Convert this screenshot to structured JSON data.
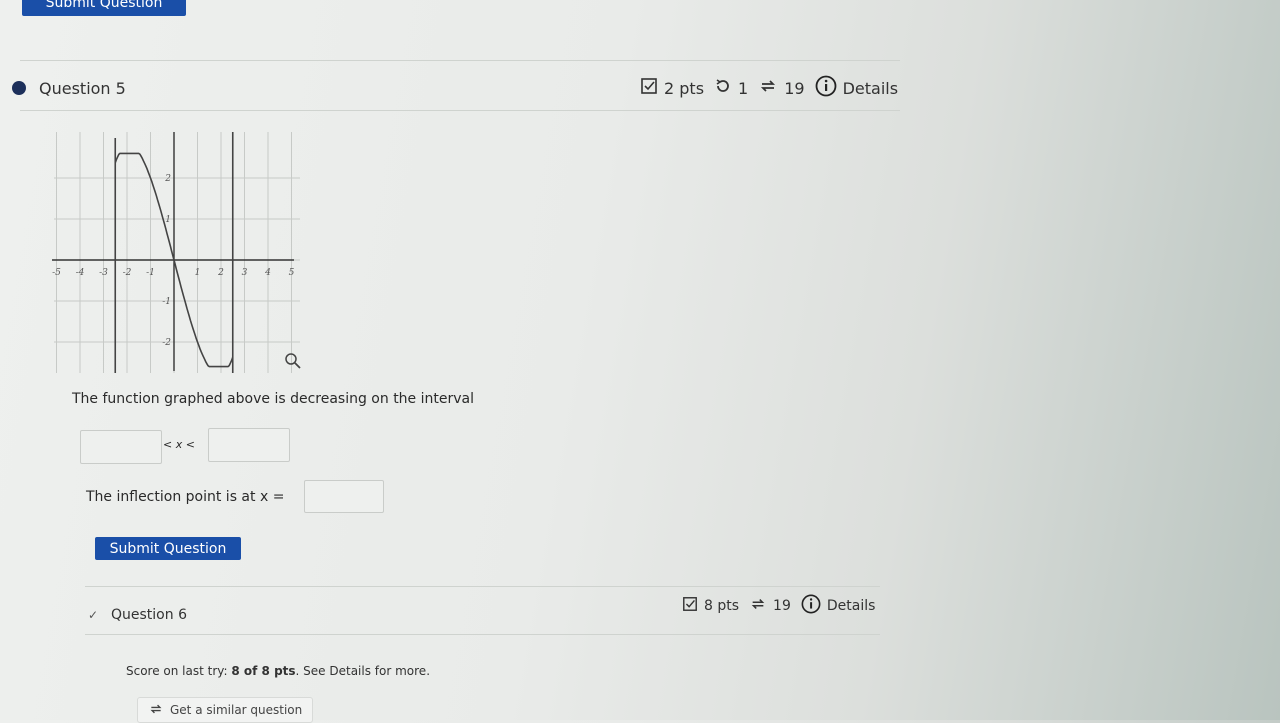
{
  "top_button": {
    "label": "Submit Question"
  },
  "question5": {
    "title": "Question 5",
    "points": "2 pts",
    "retries": "1",
    "attempts": "19",
    "details_label": "Details",
    "graph": {
      "x_ticks": [
        "-5",
        "-4",
        "-3",
        "-2",
        "-1",
        "1",
        "2",
        "3",
        "4",
        "5"
      ],
      "y_ticks": [
        "2",
        "1",
        "-1",
        "-2"
      ],
      "x_range": [
        -5,
        5
      ],
      "y_range": [
        -2.5,
        2.5
      ]
    },
    "prompt": "The function graphed above is decreasing on the interval",
    "interval_mid": "< x <",
    "inflection_label": "The inflection point is at x =",
    "interval_left_value": "",
    "interval_right_value": "",
    "inflection_value": "",
    "submit_label": "Submit Question"
  },
  "question6": {
    "check": "✓",
    "title": "Question 6",
    "points": "8 pts",
    "attempts": "19",
    "details_label": "Details",
    "score_prefix": "Score on last try: ",
    "score_value": "8 of 8 pts",
    "score_suffix": ". See Details for more.",
    "similar_label": "Get a similar question"
  }
}
